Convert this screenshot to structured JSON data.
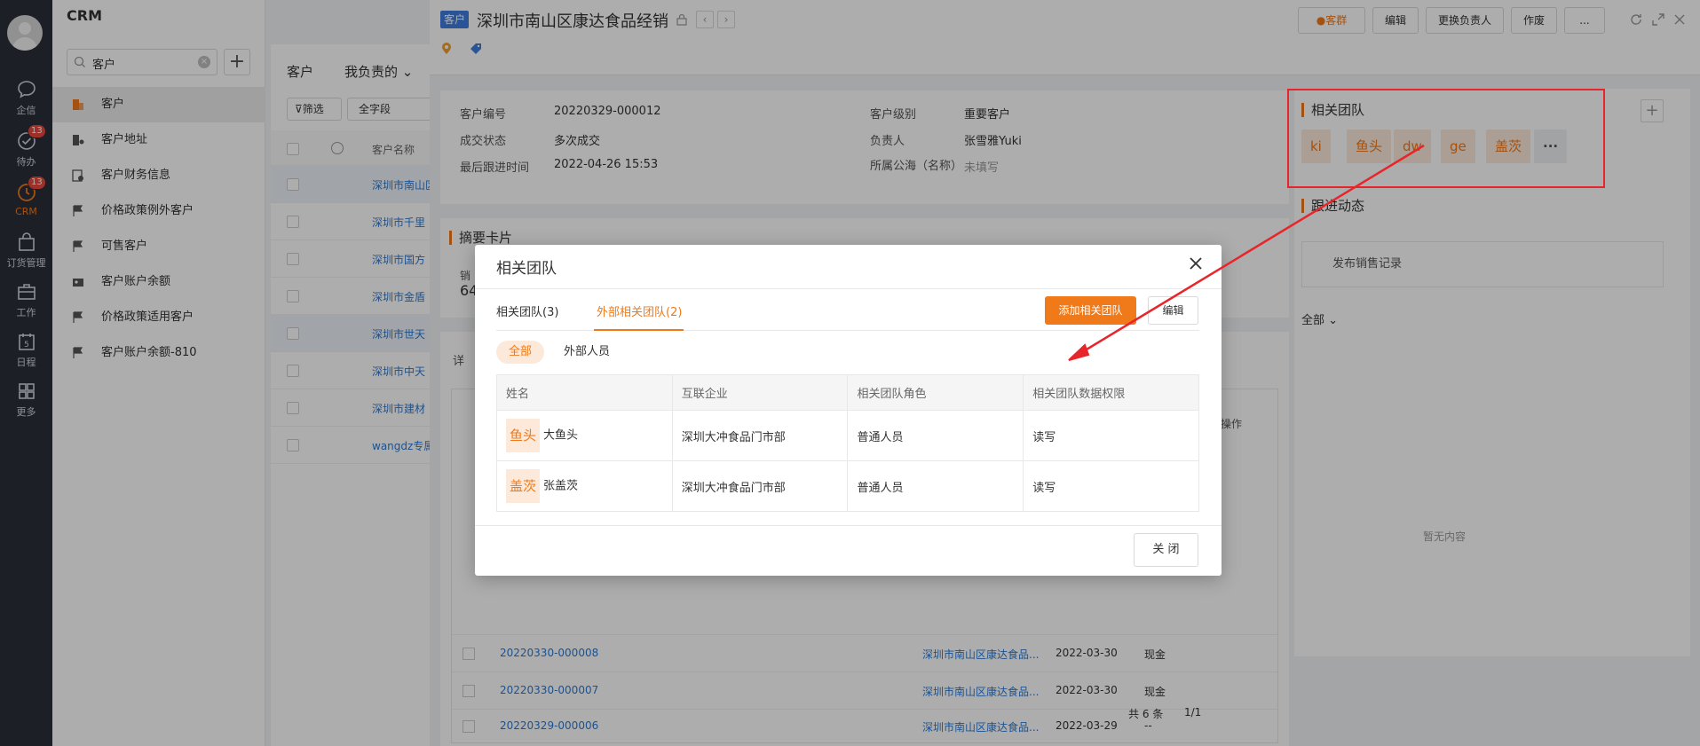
{
  "rail": {
    "items": [
      {
        "label": "企信"
      },
      {
        "label": "待办",
        "badge": "13"
      },
      {
        "label": "CRM",
        "badge": "13"
      },
      {
        "label": "订货管理"
      },
      {
        "label": "工作"
      },
      {
        "label": "日程",
        "day": "5"
      },
      {
        "label": "更多"
      }
    ]
  },
  "sidenav": {
    "title": "CRM",
    "search_value": "客户",
    "items": [
      {
        "label": "客户"
      },
      {
        "label": "客户地址"
      },
      {
        "label": "客户财务信息"
      },
      {
        "label": "价格政策例外客户"
      },
      {
        "label": "可售客户"
      },
      {
        "label": "客户账户余额"
      },
      {
        "label": "价格政策适用客户"
      },
      {
        "label": "客户账户余额-810"
      }
    ]
  },
  "list": {
    "head1": "客户",
    "head2": "我负责的",
    "filter_label": "筛选",
    "field_label": "全字段",
    "col_name": "客户名称",
    "rows": [
      "深圳市南山区",
      "深圳市千里",
      "深圳市国方",
      "深圳市金盾",
      "深圳市世天",
      "深圳市中天",
      "深圳市建材",
      "wangdz专属"
    ]
  },
  "detail": {
    "type_tag": "客户",
    "title": "深圳市南山区康达食品经销",
    "buttons": {
      "group": "客群",
      "edit": "编辑",
      "change_owner": "更换负责人",
      "void": "作废",
      "more": "..."
    },
    "info": {
      "code_label": "客户编号",
      "code_value": "20220329-000012",
      "deal_label": "成交状态",
      "deal_value": "多次成交",
      "last_label": "最后跟进时间",
      "last_value": "2022-04-26 15:53",
      "level_label": "客户级别",
      "level_value": "重要客户",
      "owner_label": "负责人",
      "owner_value": "张雪雅Yuki",
      "pool_label": "所属公海（名称）",
      "pool_value": "未填写"
    },
    "summary_title": "摘要卡片",
    "summary_label": "销",
    "summary_value": "64",
    "tab_label": "详",
    "rows": [
      {
        "code": "20220330-000008",
        "cust": "深圳市南山区康达食品...",
        "date": "2022-03-30",
        "pay": "现金"
      },
      {
        "code": "20220330-000007",
        "cust": "深圳市南山区康达食品...",
        "date": "2022-03-30",
        "pay": "现金"
      },
      {
        "code": "20220329-000006",
        "cust": "深圳市南山区康达食品...",
        "date": "2022-03-29",
        "pay": "--"
      }
    ],
    "ops_label": "操作",
    "total": "共 6 条",
    "page": "1/1"
  },
  "right": {
    "team_title": "相关团队",
    "chips": [
      "ki",
      "鱼头",
      "dw",
      "ge",
      "盖茨",
      "···"
    ],
    "follow_title": "跟进动态",
    "publish_label": "发布销售记录",
    "all_label": "全部",
    "empty_label": "暂无内容"
  },
  "modal": {
    "title": "相关团队",
    "tab1": "相关团队(3)",
    "tab2": "外部相关团队(2)",
    "add_btn": "添加相关团队",
    "edit_btn": "编辑",
    "pill_all": "全部",
    "pill_ext": "外部人员",
    "columns": [
      "姓名",
      "互联企业",
      "相关团队角色",
      "相关团队数据权限"
    ],
    "rows": [
      {
        "avatar": "鱼头",
        "name": "大鱼头",
        "org": "深圳大冲食品门市部",
        "role": "普通人员",
        "perm": "读写"
      },
      {
        "avatar": "盖茨",
        "name": "张盖茨",
        "org": "深圳大冲食品门市部",
        "role": "普通人员",
        "perm": "读写"
      }
    ],
    "close_btn": "关 闭"
  },
  "colors": {
    "accent": "#f07a1a",
    "link": "#2a7ad6",
    "rail": "#2b2f3a",
    "annotation": "#e8252a"
  }
}
